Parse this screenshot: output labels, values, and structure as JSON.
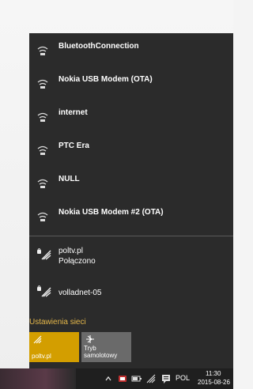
{
  "connections": [
    {
      "label": "BluetoothConnection",
      "icon": "dialup-icon"
    },
    {
      "label": "Nokia USB Modem (OTA)",
      "icon": "dialup-icon"
    },
    {
      "label": "internet",
      "icon": "dialup-icon"
    },
    {
      "label": "PTC Era",
      "icon": "dialup-icon"
    },
    {
      "label": "NULL",
      "icon": "dialup-icon"
    },
    {
      "label": "Nokia USB Modem #2 (OTA)",
      "icon": "dialup-icon"
    }
  ],
  "wifi": [
    {
      "name": "poltv.pl",
      "status": "Połączono",
      "icon": "wifi-secured-icon"
    },
    {
      "name": "volladnet-05",
      "status": "",
      "icon": "wifi-secured-icon"
    }
  ],
  "settings_link": "Ustawienia sieci",
  "tiles": {
    "wifi": {
      "label": "poltv.pl",
      "icon": "wifi-icon",
      "color": "#d39e00"
    },
    "airplane": {
      "label": "Tryb samolotowy",
      "icon": "airplane-icon",
      "color": "#6a6a6a"
    }
  },
  "taskbar": {
    "language": "POL",
    "time": "11:30",
    "date": "2015-08-26",
    "icons": [
      "chevron-up-icon",
      "security-icon",
      "battery-icon",
      "network-icon",
      "notifications-icon"
    ]
  },
  "colors": {
    "panel_bg": "#2b2b2b",
    "accent": "#e6b84a",
    "taskbar_bg": "#1f1f1f"
  }
}
